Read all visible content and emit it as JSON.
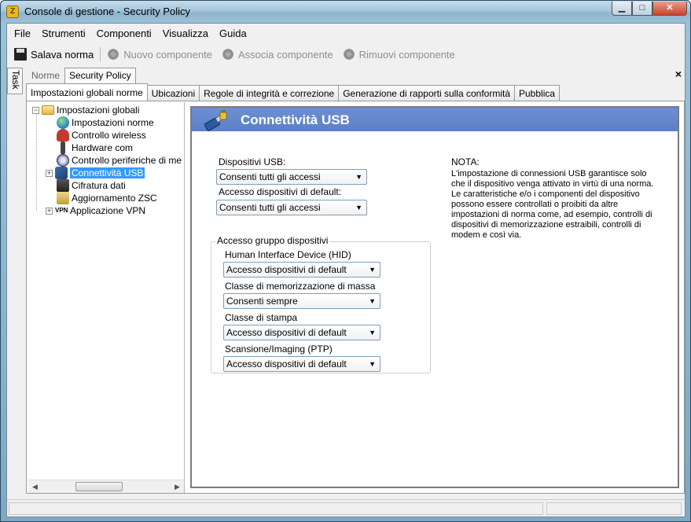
{
  "window": {
    "title": "Console di gestione  - Security Policy",
    "controls": {
      "minimize": "▁",
      "maximize": "□",
      "close": "✕"
    }
  },
  "menu": [
    "File",
    "Strumenti",
    "Componenti",
    "Visualizza",
    "Guida"
  ],
  "toolbar": {
    "save_label": "Salava norma",
    "new_component_label": "Nuovo componente",
    "associate_component_label": "Associa componente",
    "remove_component_label": "Rimuovi componente"
  },
  "task_label": "Task",
  "outer_tabs": [
    "Norme",
    "Security Policy"
  ],
  "close_glyph": "×",
  "inner_tabs": [
    "Impostazioni globali norme",
    "Ubicazioni",
    "Regole di integrità e correzione",
    "Generazione di rapporti sulla conformità",
    "Pubblica"
  ],
  "tree": {
    "root": "Impostazioni globali",
    "items": [
      {
        "label": "Impostazioni norme",
        "icon": "globe-icon"
      },
      {
        "label": "Controllo wireless",
        "icon": "wireless-icon"
      },
      {
        "label": "Hardware com",
        "icon": "hardware-icon"
      },
      {
        "label": "Controllo periferiche di me",
        "icon": "disc-icon"
      },
      {
        "label": "Connettività USB",
        "icon": "usb-icon",
        "selected": true
      },
      {
        "label": "Cifratura dati",
        "icon": "encryption-icon"
      },
      {
        "label": "Aggiornamento ZSC",
        "icon": "update-icon"
      },
      {
        "label": "Applicazione VPN",
        "icon": "vpn-icon"
      }
    ],
    "expand_plus": "+",
    "expand_minus": "−",
    "vpn_text": "VPN"
  },
  "content": {
    "title": "Connettività USB",
    "usb_devices_label": "Dispositivi USB:",
    "usb_devices_value": "Consenti tutti gli accessi",
    "default_access_label": "Accesso dispositivi di default:",
    "default_access_value": "Consenti tutti gli accessi",
    "group": {
      "title": "Accesso gruppo dispositivi",
      "hid_label": "Human Interface Device (HID)",
      "hid_value": "Accesso dispositivi di default",
      "mass_storage_label": "Classe di memorizzazione di massa",
      "mass_storage_value": "Consenti sempre",
      "print_label": "Classe di stampa",
      "print_value": "Accesso dispositivi di default",
      "ptp_label": "Scansione/Imaging (PTP)",
      "ptp_value": "Accesso dispositivi di default"
    },
    "note_title": "NOTA:",
    "note_text": "L'impostazione di connessioni USB garantisce solo che il dispositivo venga attivato in virtù di una norma.  Le caratteristiche e/o i componenti del dispositivo possono essere controllati o proibiti da altre impostazioni di norma come, ad esempio, controlli di dispositivi di memorizzazione estraibili, controlli di modem e così via."
  },
  "combo_arrow": "▼",
  "scroll_left": "◀",
  "scroll_right": "▶"
}
